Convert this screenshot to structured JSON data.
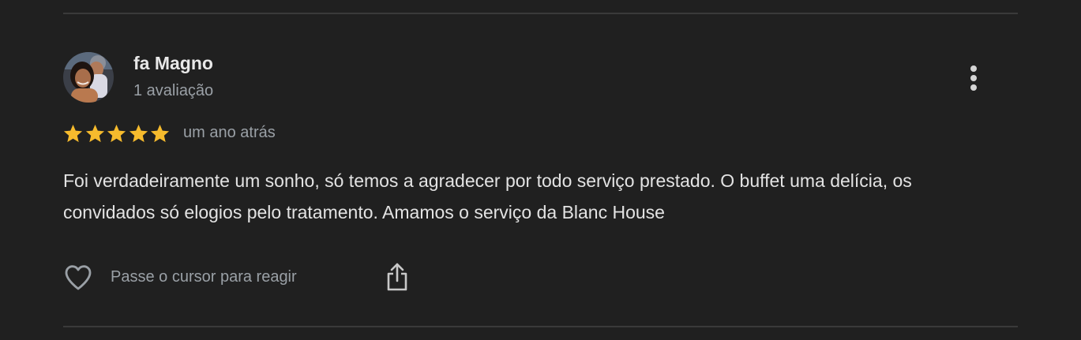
{
  "review": {
    "author": {
      "name": "fa Magno",
      "meta": "1 avaliação",
      "avatar_icon": "user-photo-avatar"
    },
    "rating": 5,
    "rating_max": 5,
    "star_color": "#f6bb2d",
    "date": "um ano atrás",
    "text": "Foi verdadeiramente um sonho, só temos a agradecer por todo serviço prestado. O buffet uma delícia, os convidados só elogios pelo tratamento. Amamos o serviço da Blanc House",
    "actions": {
      "react_label": "Passe o cursor para reagir",
      "react_icon": "heart-outline-icon",
      "share_icon": "share-icon",
      "more_icon": "more-vertical-icon"
    }
  }
}
